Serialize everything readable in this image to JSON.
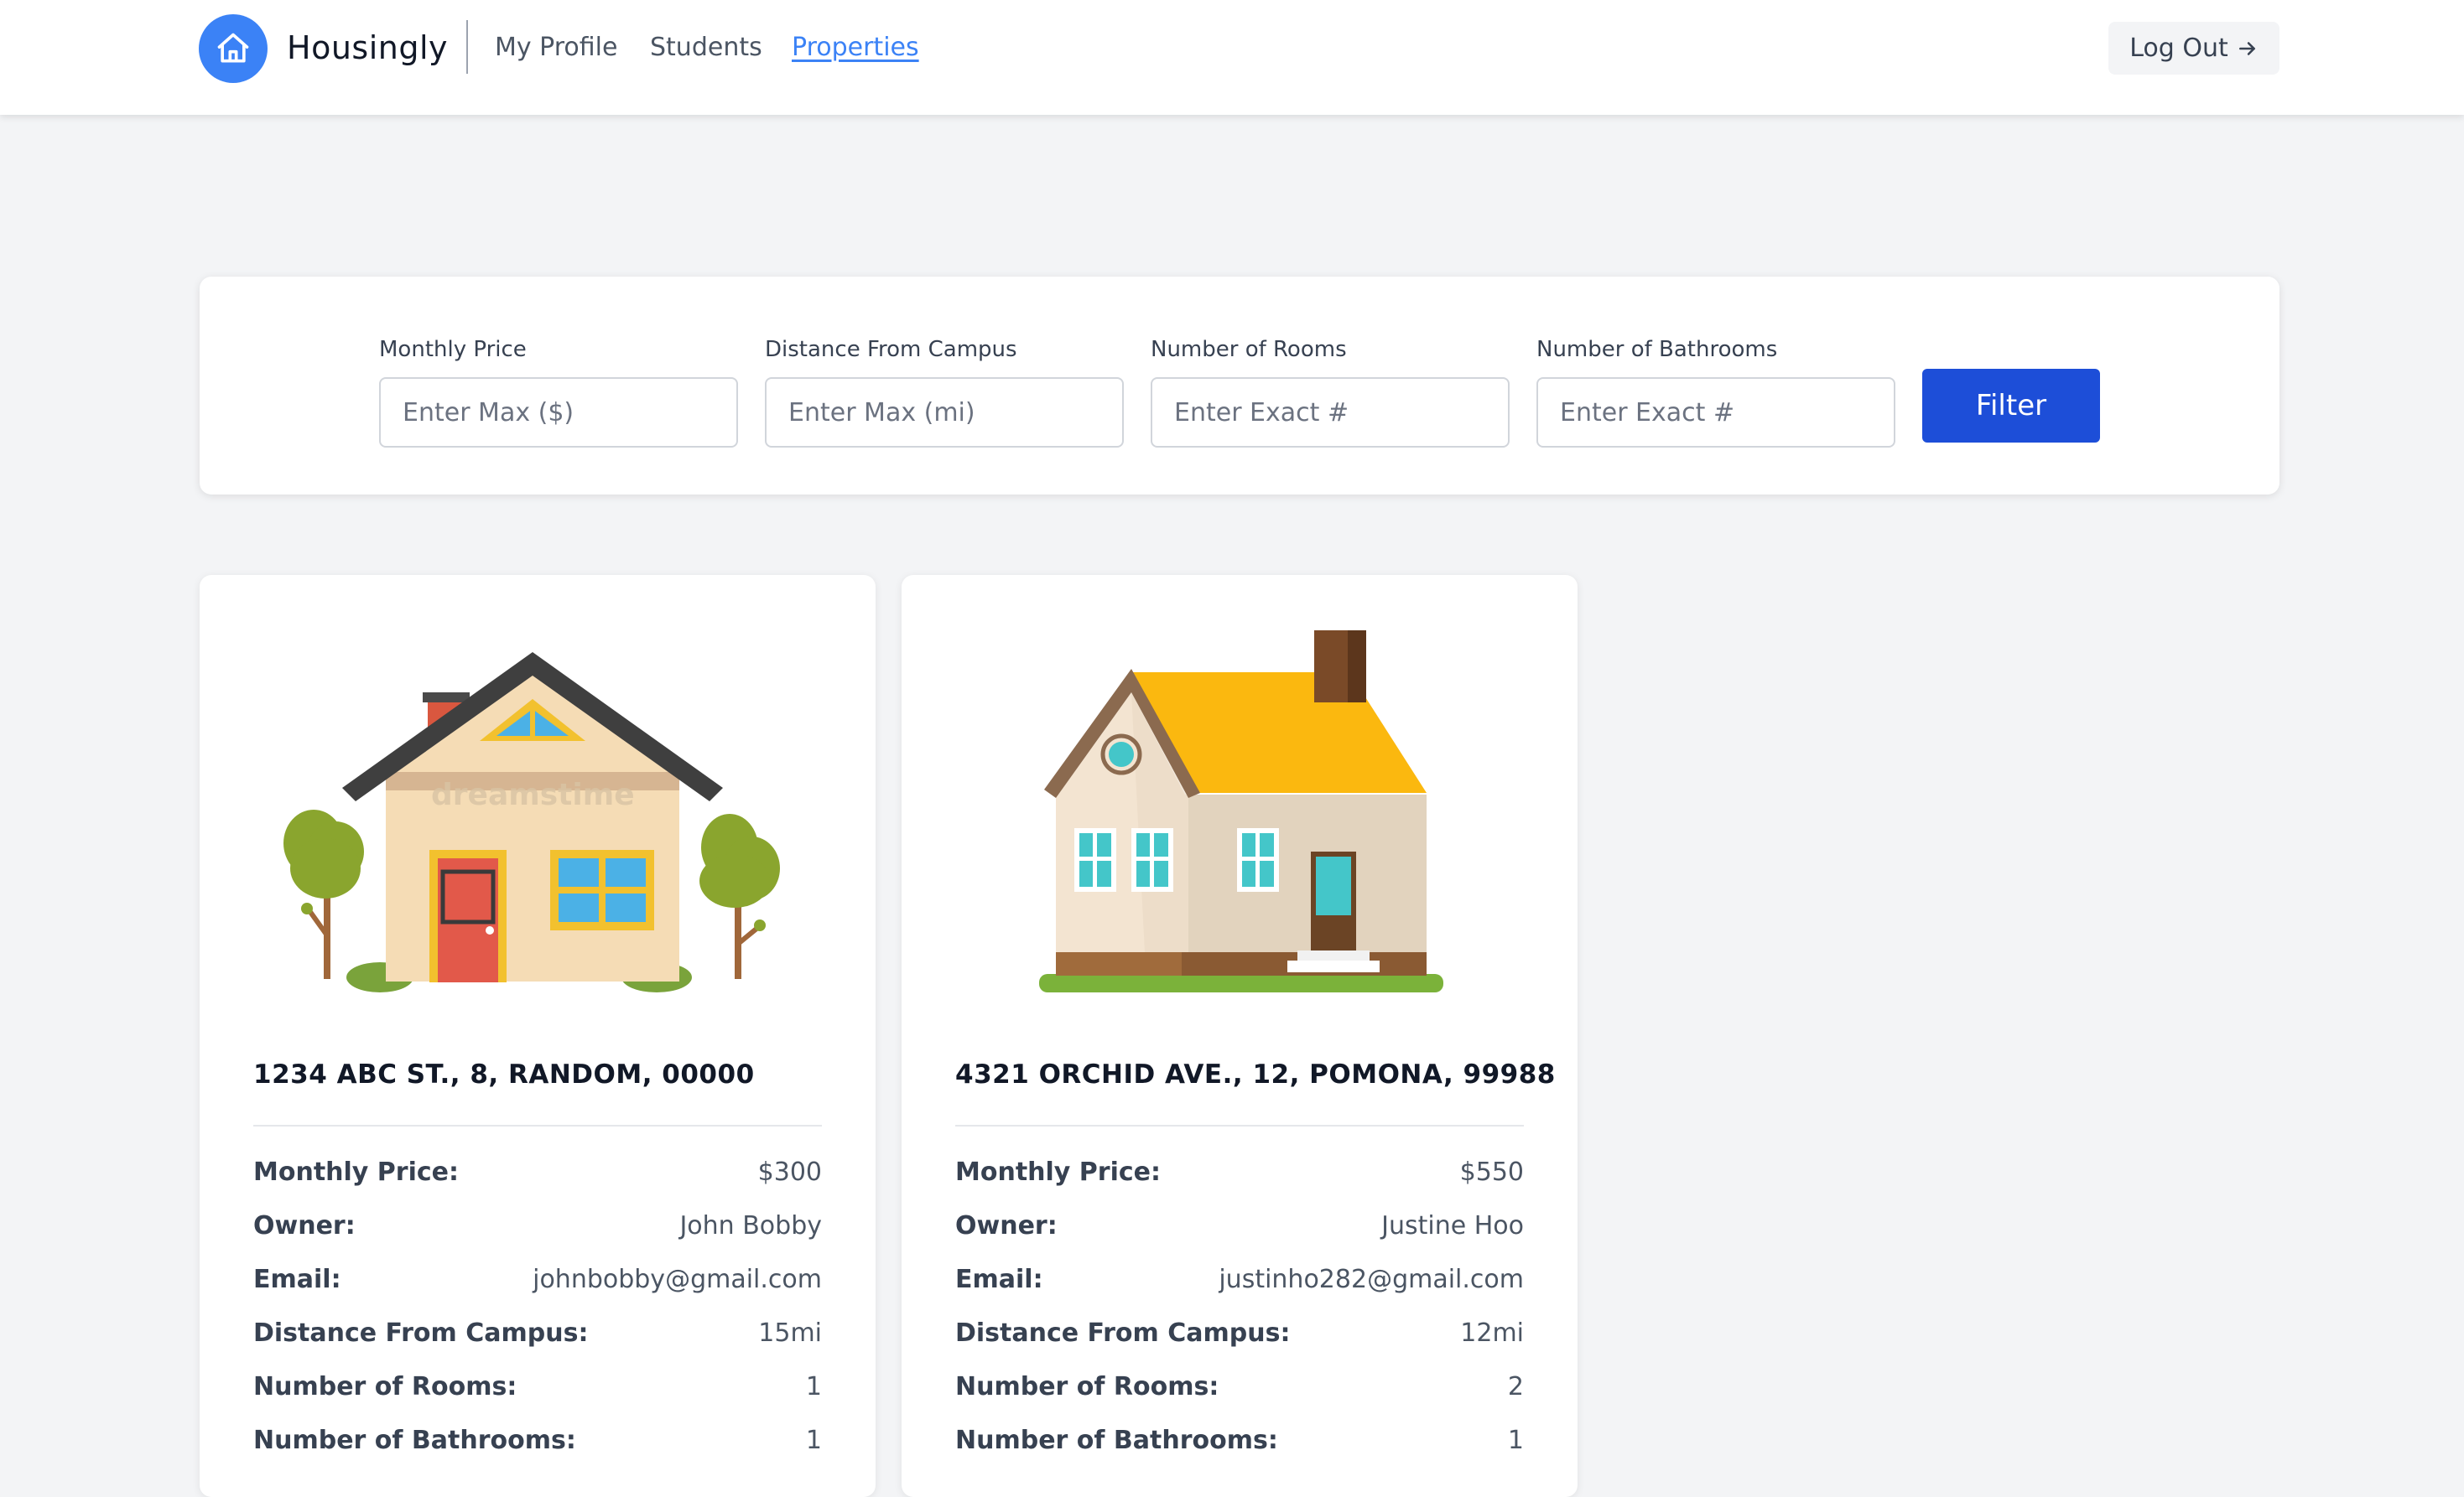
{
  "navbar": {
    "brand": "Housingly",
    "logo_icon": "home-icon",
    "links": [
      {
        "label": "My Profile",
        "active": false
      },
      {
        "label": "Students",
        "active": false
      },
      {
        "label": "Properties",
        "active": true
      }
    ],
    "logout_label": "Log Out",
    "logout_icon": "arrow-right-icon"
  },
  "filters": {
    "fields": [
      {
        "label": "Monthly Price",
        "placeholder": "Enter Max ($)"
      },
      {
        "label": "Distance From Campus",
        "placeholder": "Enter Max (mi)"
      },
      {
        "label": "Number of Rooms",
        "placeholder": "Enter Exact #"
      },
      {
        "label": "Number of Bathrooms",
        "placeholder": "Enter Exact #"
      }
    ],
    "button_label": "Filter"
  },
  "field_labels": {
    "price": "Monthly Price:",
    "owner": "Owner:",
    "email": "Email:",
    "distance": "Distance From Campus:",
    "rooms": "Number of Rooms:",
    "bathrooms": "Number of Bathrooms:"
  },
  "properties": [
    {
      "address": "1234 ABC ST., 8, RANDOM, 00000",
      "price": "$300",
      "owner": "John Bobby",
      "email": "johnbobby@gmail.com",
      "distance": "15mi",
      "rooms": "1",
      "bathrooms": "1",
      "image_watermark": "dreamstime"
    },
    {
      "address": "4321 ORCHID AVE., 12, POMONA, 99988",
      "price": "$550",
      "owner": "Justine Hoo",
      "email": "justinho282@gmail.com",
      "distance": "12mi",
      "rooms": "2",
      "bathrooms": "1"
    }
  ],
  "colors": {
    "primary": "#3b82f6",
    "button": "#1d4ed8",
    "background": "#f3f4f6"
  }
}
